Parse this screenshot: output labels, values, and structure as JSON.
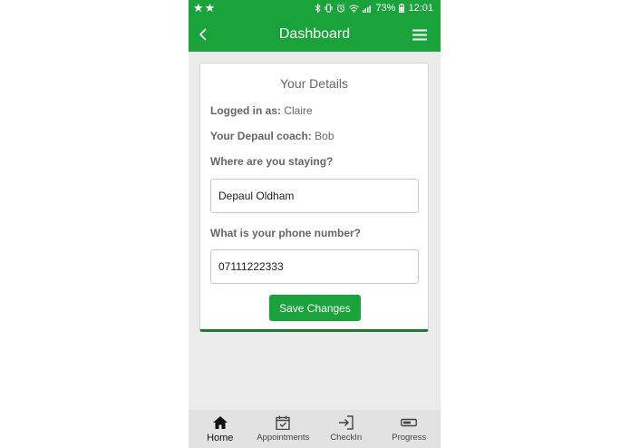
{
  "status_bar": {
    "stars": "★★",
    "battery_percent": "73%",
    "time": "12:01"
  },
  "app_bar": {
    "title": "Dashboard"
  },
  "details": {
    "title": "Your Details",
    "logged_in_label": "Logged in as:",
    "logged_in_value": "Claire",
    "coach_label": "Your Depaul coach:",
    "coach_value": "Bob",
    "staying_label": "Where are you staying?",
    "staying_value": "Depaul Oldham",
    "phone_label": "What is your phone number?",
    "phone_value": "07111222333",
    "save_label": "Save Changes"
  },
  "bottom_nav": {
    "items": [
      {
        "label": "Home",
        "icon": "home-icon"
      },
      {
        "label": "Appointments",
        "icon": "calendar-check-icon"
      },
      {
        "label": "CheckIn",
        "icon": "sign-in-icon"
      },
      {
        "label": "Progress",
        "icon": "progress-bar-icon"
      }
    ],
    "active_index": 0
  },
  "colors": {
    "primary": "#1aa33a",
    "card_border_bottom": "#1a7a2e",
    "background": "#ebebeb"
  }
}
